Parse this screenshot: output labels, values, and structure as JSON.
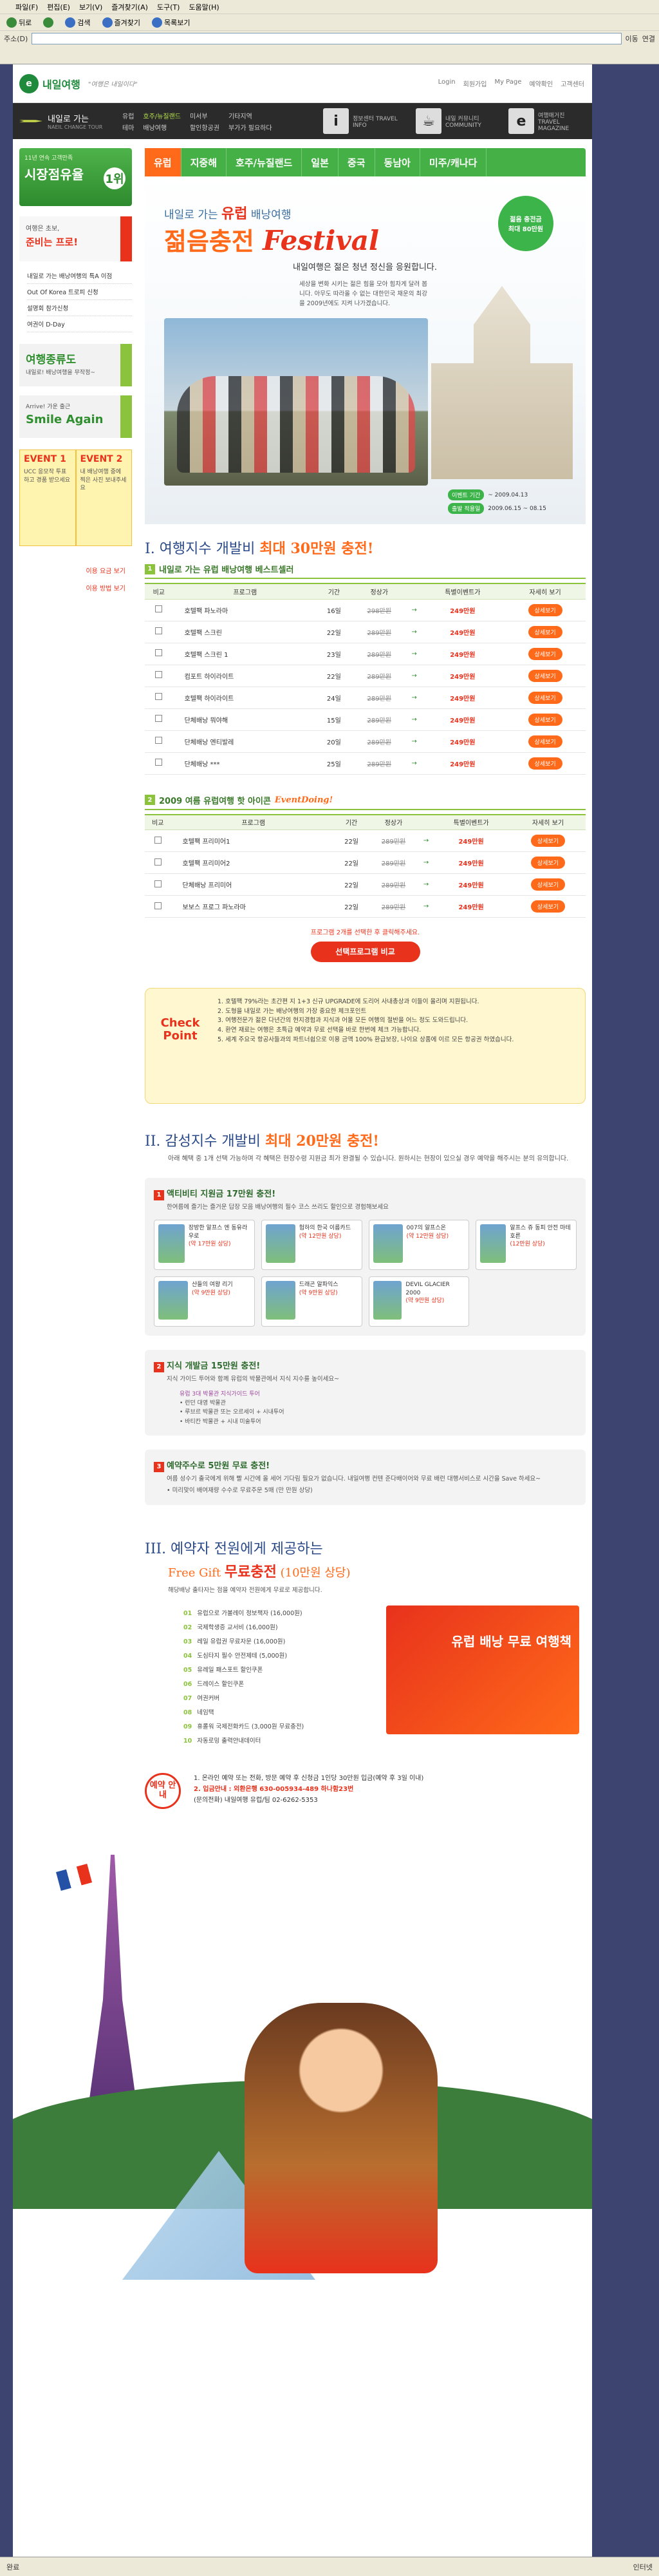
{
  "browser": {
    "menu": [
      "파일(F)",
      "편집(E)",
      "보기(V)",
      "즐겨찾기(A)",
      "도구(T)",
      "도움말(H)"
    ],
    "toolbar": {
      "back": "뒤로",
      "search": "검색",
      "favorites": "즐겨찾기",
      "history": "목록보기"
    },
    "address_label": "주소(D)",
    "go_label": "이동",
    "links_label": "연결",
    "status_left": "완료",
    "status_right": "인터넷"
  },
  "site": {
    "logo_mark": "e",
    "logo_name": "내일여행",
    "slogan": "\"여행은 내일이다\"",
    "top_links": [
      "Login",
      "회원가입",
      "My Page",
      "예약확인",
      "고객센터"
    ],
    "gnb_brand": "내일로 가는",
    "gnb_brand_sub": "NAEIL CHANGE TOUR",
    "gnb_menus": [
      "유럽",
      "호주/뉴질랜드",
      "미서부",
      "기타지역",
      "테마",
      "배낭여행",
      "할인항공권",
      "부가가 필요하다"
    ],
    "gnb_icons": [
      {
        "glyph": "i",
        "label": "정보센터 TRAVEL INFO"
      },
      {
        "glyph": "☕",
        "label": "내일 커뮤니티 COMMUNITY"
      },
      {
        "glyph": "e",
        "label": "여행매거진 TRAVEL MAGAZINE"
      }
    ]
  },
  "sidebar": {
    "badge_small": "11년 연속 고객만족",
    "badge_big": "시장점유율",
    "badge_num": "1위",
    "card_a": "여행은 초보,",
    "card_b": "준비는 프로!",
    "list": [
      "내일로 가는 배낭여행의 특A 이점",
      "Out Of Korea 트로피 신청",
      "설명회 참가신청",
      "여권이 D-Day"
    ],
    "banner1_big": "여행종류도",
    "banner1_small": "내일로! 배낭여행을 무작정~",
    "banner2_small": "Arrive! 가운 출근",
    "banner2_big": "Smile Again",
    "event1_title": "EVENT 1",
    "event1_desc": "UCC 응모작 투표하고 경품 받으세요",
    "event2_title": "EVENT 2",
    "event2_desc": "내 배낭여행 중에 찍은 사진 보내주세요",
    "links": [
      "이용 요금 보기",
      "이용 방법 보기"
    ]
  },
  "main": {
    "tabs": [
      "유럽",
      "지중해",
      "호주/뉴질랜드",
      "일본",
      "중국",
      "동남아",
      "미주/캐나다"
    ],
    "hero": {
      "kicker_pre": "내일로 가는",
      "kicker_hl": "유럽",
      "kicker_post": "배낭여행",
      "title": "젊음충전",
      "title_en": "Festival",
      "sub": "내일여행은 젊은 청년 정신을 응원합니다.",
      "desc": "세상을 변화 시키는 젊은 힘을 모아 힘차게 달려 봅니다. 아무도 따라올 수 없는 대한민국 채운의 최강을 2009년에도 지켜 나가겠습니다.",
      "circle_a": "젊음 충전금",
      "circle_b": "최대 80만원",
      "period_label1": "이벤트 기간",
      "period_value1": "~ 2009.04.13",
      "period_label2": "출발 적용일",
      "period_value2": "2009.06.15 ~ 08.15"
    },
    "section1": {
      "title_pre": "I. 여행지수 개발비",
      "title_hl": "최대 30만원 충전!",
      "subhead": "내일로 가는 유럽 배낭여행 베스트셀러",
      "headers": [
        "비교",
        "프로그램",
        "기간",
        "정상가",
        "",
        "특별이벤트가",
        "자세히 보기"
      ],
      "rows": [
        [
          "호텔팩 파노라마",
          "16일",
          "298만원",
          "→",
          "249만원",
          "상세보기"
        ],
        [
          "호텔팩 스크린",
          "22일",
          "289만원",
          "→",
          "249만원",
          "상세보기"
        ],
        [
          "호텔팩 스크린 1",
          "23일",
          "289만원",
          "→",
          "249만원",
          "상세보기"
        ],
        [
          "컴포트 하이라이트",
          "22일",
          "289만원",
          "→",
          "249만원",
          "상세보기"
        ],
        [
          "호텔팩 하이라이트",
          "24일",
          "289만원",
          "→",
          "249만원",
          "상세보기"
        ],
        [
          "단체배낭 뭐야해",
          "15일",
          "289만원",
          "→",
          "249만원",
          "상세보기"
        ],
        [
          "단체배낭 엔티발레",
          "20일",
          "289만원",
          "→",
          "249만원",
          "상세보기"
        ],
        [
          "단체배낭 ***",
          "25일",
          "289만원",
          "→",
          "249만원",
          "상세보기"
        ]
      ]
    },
    "section1b": {
      "subhead": "2009 여름 유럽여행 핫 아이콘",
      "subhead_script": "EventDoing!",
      "headers": [
        "비교",
        "프로그램",
        "기간",
        "정상가",
        "",
        "특별이벤트가",
        "자세히 보기"
      ],
      "rows": [
        [
          "호텔팩 프리미어1",
          "22일",
          "289만원",
          "→",
          "249만원",
          "상세보기"
        ],
        [
          "호텔팩 프리미어2",
          "22일",
          "289만원",
          "→",
          "249만원",
          "상세보기"
        ],
        [
          "단체배낭 프리미어",
          "22일",
          "289만원",
          "→",
          "249만원",
          "상세보기"
        ],
        [
          "보보스 프로그 파노라마",
          "22일",
          "289만원",
          "→",
          "249만원",
          "상세보기"
        ]
      ],
      "compare_note": "프로그램 2개를 선택한 후 클릭해주세요.",
      "compare_btn": "선택프로그램 비교"
    },
    "check": {
      "title": "Check Point",
      "items": [
        "1. 호텔팩 79%라는 초간편 지 1+3 신규 UPGRADE에 도리어 사내총상과 이들이 올리며 지원됩니다.",
        "2. 도형을 내일로 가는 배낭여행의 가장 중요한 체크포인트",
        "3. 여행전문가 젊은 다년간의 현지경험과 지식과 어울 모든 여행의 절반을 어느 정도 도와드립니다.",
        "4. 환연 재료는 여행은 초특급 예약과 무료 선택을 바로 한번에 체크 가능합니다.",
        "5. 세계 주요국 항공사들과의 파트너쉽으로 이용 금액 100% 환급보장, 나이요 상품에 이르 모든 항공권 하였습니다."
      ]
    },
    "section2": {
      "title_pre": "II. 감성지수 개발비",
      "title_hl": "최대 20만원 충전!",
      "lead": "아래 혜택 중 1개 선택 가능하며 각 혜택은 현장수령 지원금 최가 완결될 수 있습니다. 원하시는 현장이 있으실 경우 예약을 해주시는 분의 유의합니다.",
      "panel1_title": "액티비티 지원금 17만원 충전!",
      "panel1_desc": "한여름에 즐기는 즐거운 답장 모음 배낭여행의 필수 코스 쓰리도 할인으로 경험해보세요",
      "activities": [
        {
          "name": "장방한 알프스 엔 동유라우로",
          "price": "(약 17만원 상당)"
        },
        {
          "name": "험하의 한국 이름카드",
          "price": "(약 12만원 상당)"
        },
        {
          "name": "007의 알프스온",
          "price": "(약 12만원 상당)"
        },
        {
          "name": "알프스 쥬 동피 안전 마테호른",
          "price": "(12만원 상당)"
        },
        {
          "name": "산들의 여왕 리기",
          "price": "(약 9만원 상당)"
        },
        {
          "name": "드래곤 알파익스",
          "price": "(약 9만원 상당)"
        },
        {
          "name": "DEVIL GLACIER 2000",
          "price": "(약 9만원 상당)"
        }
      ],
      "panel2_title": "지식 개발금 15만원 충전!",
      "panel2_desc": "지식 가이드 투어와 함께 유럽의 박물관에서 지식 지수를 높이세요~",
      "museum_lines": [
        "유럽 3대 박물관 지식가이드 투어",
        "• 런던 대영 박물관",
        "• 루브르 박물관 또는 오르세이 + 시내투어",
        "• 바티칸 박물관 + 시내 미술투어"
      ],
      "panel3_title": "예약주수로 5만원 무료 충전!",
      "panel3_desc": "여름 성수기 출국에게 위해 빨 시간에 올 세어 기다림 필요가 없습니다. 내일여행 컨텐 준다배이어와 무료 배런 대행서비스로 시간을 Save 하세요~",
      "panel3_note": "• 미리맞이 배여재량 수수로 무료주문 5매 (만 만원 상당)"
    },
    "section3": {
      "title": "III. 예약자 전원에게 제공하는",
      "gift_pre": "Free Gift",
      "gift_hl": "무료충전",
      "gift_post": "(10만원 상당)",
      "lead": "해당배낭 출타자는 점을 예약자 전원에게 무료로 제공합니다.",
      "items": [
        {
          "no": "01",
          "text": "유럽으로 가볼레이 정보책자 (16,000원)"
        },
        {
          "no": "02",
          "text": "국제학생증 교서비 (16,000원)"
        },
        {
          "no": "03",
          "text": "레일 유럽권 무료자문 (16,000원)"
        },
        {
          "no": "04",
          "text": "도심타지 필수 안전제테 (5,000원)"
        },
        {
          "no": "05",
          "text": "유레일 패스포트 할인쿠폰"
        },
        {
          "no": "06",
          "text": "드레이스 할인쿠폰"
        },
        {
          "no": "07",
          "text": "여권커버"
        },
        {
          "no": "08",
          "text": "네임택"
        },
        {
          "no": "09",
          "text": "휴롤워 국제전화카드 (3,000원 무료충전)"
        },
        {
          "no": "10",
          "text": "자동로밍 출력안내데이터"
        }
      ],
      "guides_label": "유럽 배낭 무료 여행책",
      "reserve_tag": "예약 안내",
      "reserve_lines": [
        "1. 온라인 예약 또는 전화, 방문 예약 후 신청금 1인당 30만원 입금(예약 후 3일 이내)",
        "2. 입금안내 : 외환은행 630-005934-489 하나함23번",
        "(문의전화) 내일여행 유럽/팀 02-6262-5353"
      ]
    }
  },
  "colors": {
    "accent_orange": "#ff6a1a",
    "accent_red": "#e8321c",
    "accent_green": "#45b045",
    "page_bg": "#3d4470"
  }
}
